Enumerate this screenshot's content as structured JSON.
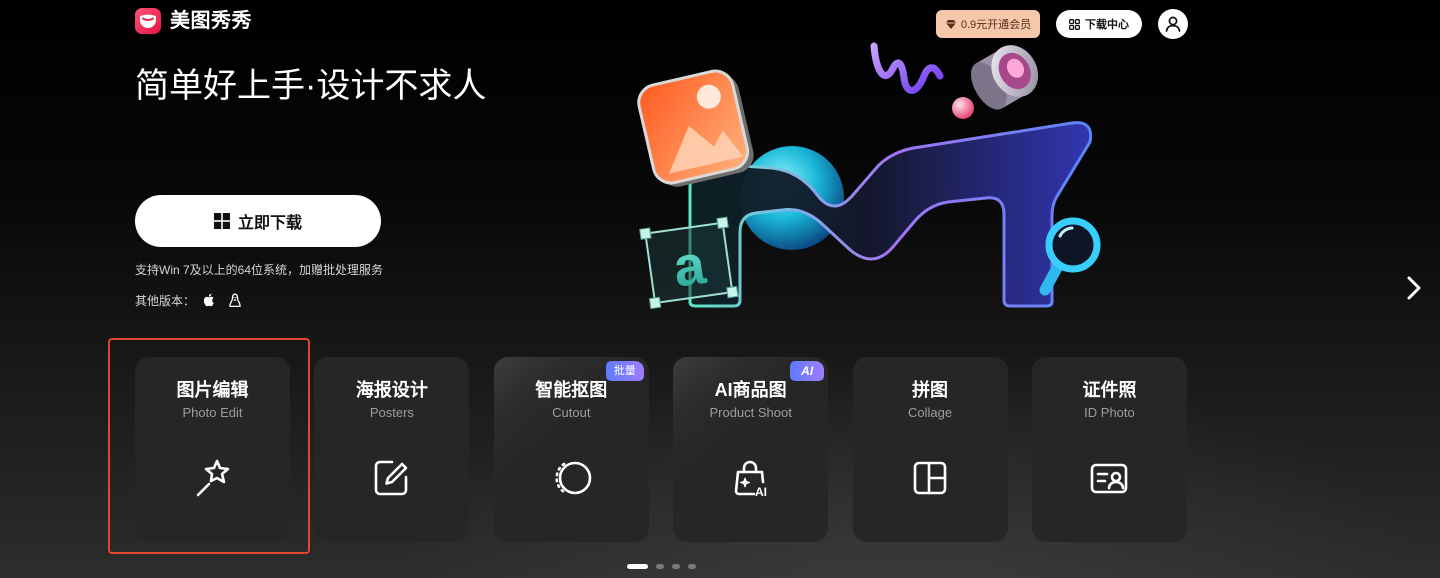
{
  "brand": {
    "name": "美图秀秀",
    "logo_icon": "meitu-logo-icon"
  },
  "header": {
    "vip_label": "0.9元开通会员",
    "vip_icon": "diamond-icon",
    "download_center_label": "下载中心",
    "download_center_icon": "grid-icon",
    "avatar_icon": "user-icon"
  },
  "hero": {
    "title": "简单好上手·设计不求人",
    "download_label": "立即下载",
    "download_icon": "windows-icon",
    "support_text": "支持Win 7及以上的64位系统，加赠批处理服务",
    "other_versions_label": "其他版本：",
    "other_version_icons": [
      "apple-icon",
      "linux-icon"
    ],
    "illustration_glyph": "a"
  },
  "tools": [
    {
      "title": "图片编辑",
      "subtitle": "Photo Edit",
      "icon": "magic-wand-icon",
      "highlighted": true
    },
    {
      "title": "海报设计",
      "subtitle": "Posters",
      "icon": "poster-edit-icon"
    },
    {
      "title": "智能抠图",
      "subtitle": "Cutout",
      "icon": "cutout-icon",
      "badge": "批量"
    },
    {
      "title": "AI商品图",
      "subtitle": "Product Shoot",
      "icon": "product-bag-icon",
      "badge": "AI",
      "icon_text": "AI"
    },
    {
      "title": "拼图",
      "subtitle": "Collage",
      "icon": "collage-icon"
    },
    {
      "title": "证件照",
      "subtitle": "ID Photo",
      "icon": "id-card-icon"
    }
  ],
  "carousel": {
    "page_count": 4,
    "active_index": 0,
    "next_icon": "chevron-right-icon"
  },
  "colors": {
    "page_background": "#000000",
    "card_background": "#262626",
    "selection_outline": "#e3452f",
    "vip_badge": "#f5c8ab",
    "tag_gradient_start": "#5d7bff",
    "tag_gradient_end": "#a07cff",
    "brand": "#f0305a"
  }
}
